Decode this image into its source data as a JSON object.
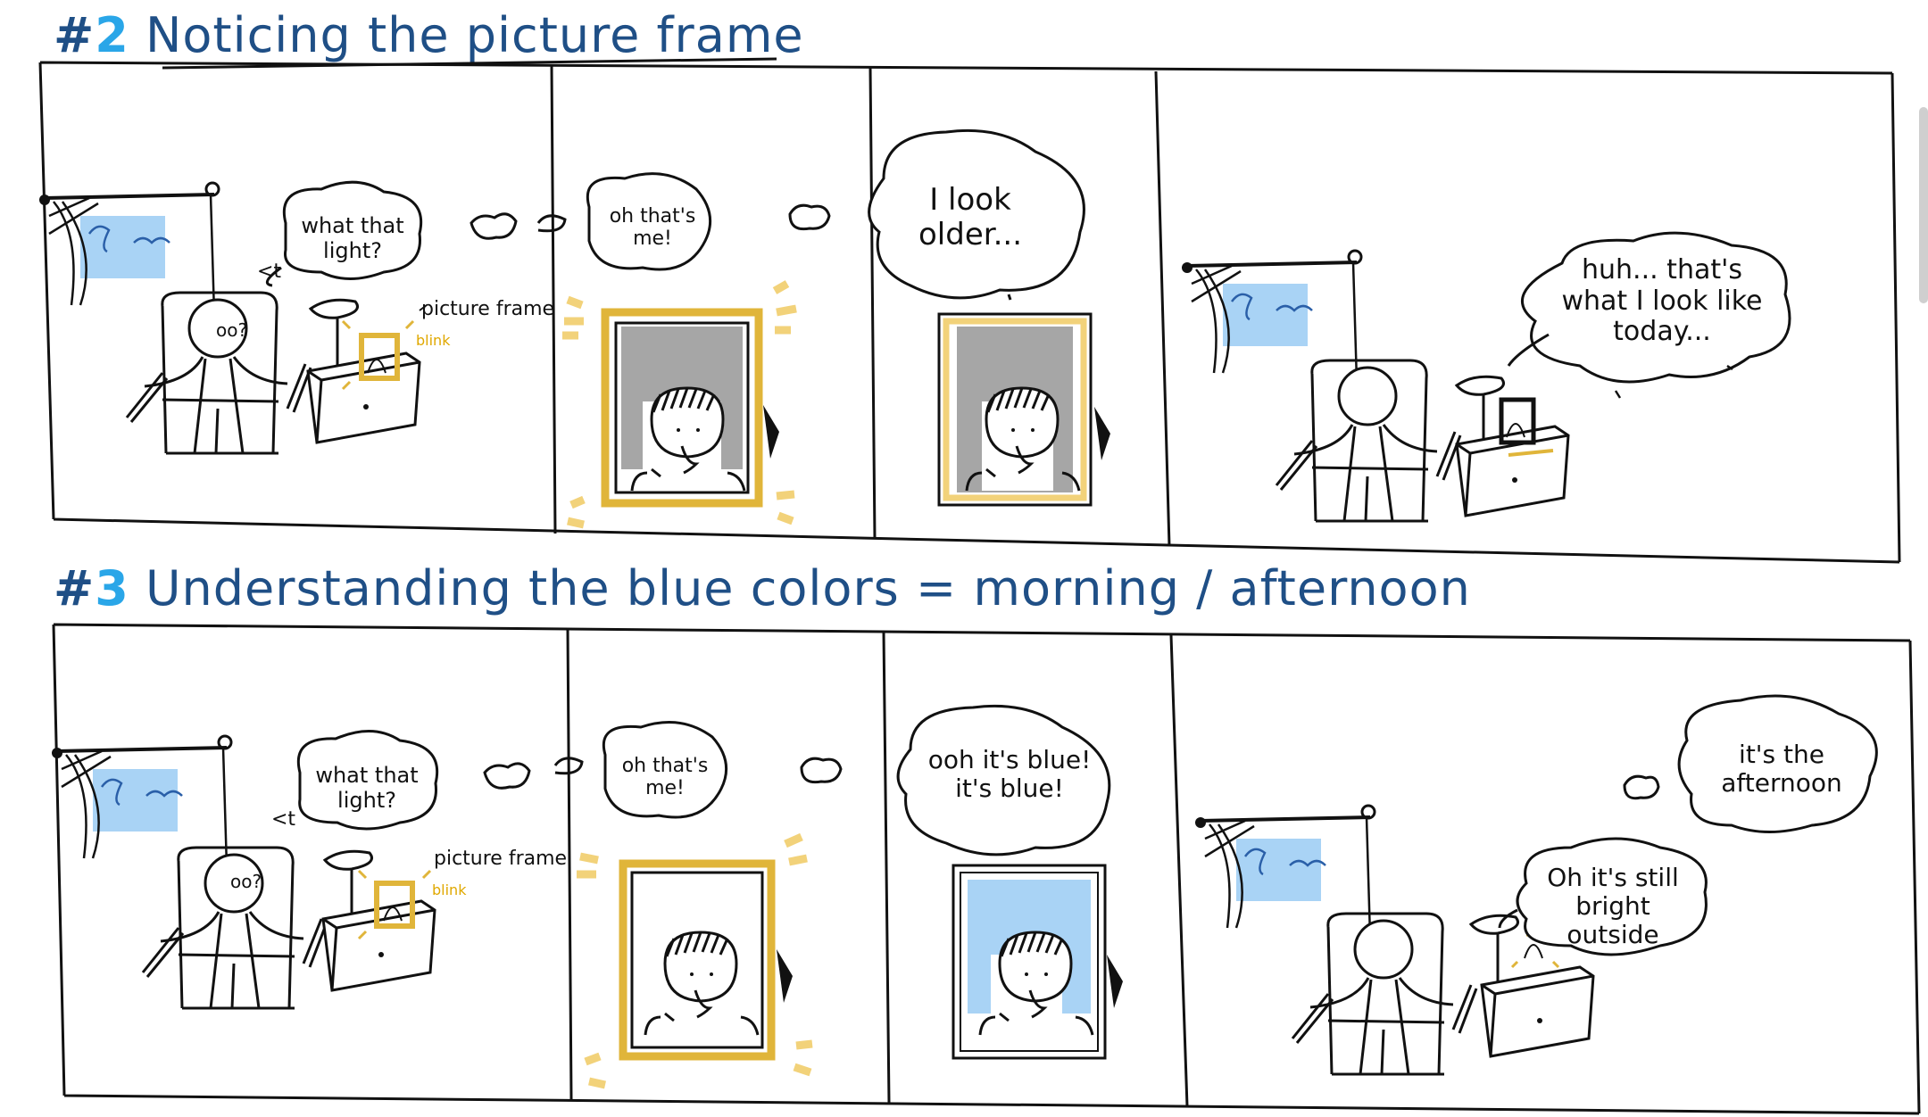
{
  "rows": [
    {
      "number_prefix": "#",
      "number_digit": "2",
      "title": "Noticing the picture frame",
      "panel1": {
        "bubble": "what that light?",
        "pointer": "<t",
        "frame_label": "picture frame",
        "blink": "blink",
        "face": "oo?"
      },
      "panel2": {
        "bubble": "oh that's me!"
      },
      "panel3": {
        "bubble": "I look older..."
      },
      "panel4": {
        "bubble": "huh... that's what I look like today..."
      }
    },
    {
      "number_prefix": "#",
      "number_digit": "3",
      "title": "Understanding the blue colors = morning / afternoon",
      "panel1": {
        "bubble": "what that light?",
        "pointer": "<t",
        "frame_label": "picture frame",
        "blink": "blink",
        "face": "oo?"
      },
      "panel2": {
        "bubble": "oh that's me!"
      },
      "panel3": {
        "bubble": "ooh it's blue! it's blue!"
      },
      "panel4": {
        "bubble_top": "it's the afternoon",
        "bubble_bottom": "Oh it's still bright outside"
      }
    }
  ],
  "colors": {
    "ink": "#111111",
    "title_blue": "#1f4f86",
    "accent_blue": "#2aa6e8",
    "sky_blue": "#a9d3f5",
    "frame_gold": "#f2d27a",
    "frame_gold_dark": "#e0b53a",
    "grey_fill": "#a6a6a6"
  }
}
